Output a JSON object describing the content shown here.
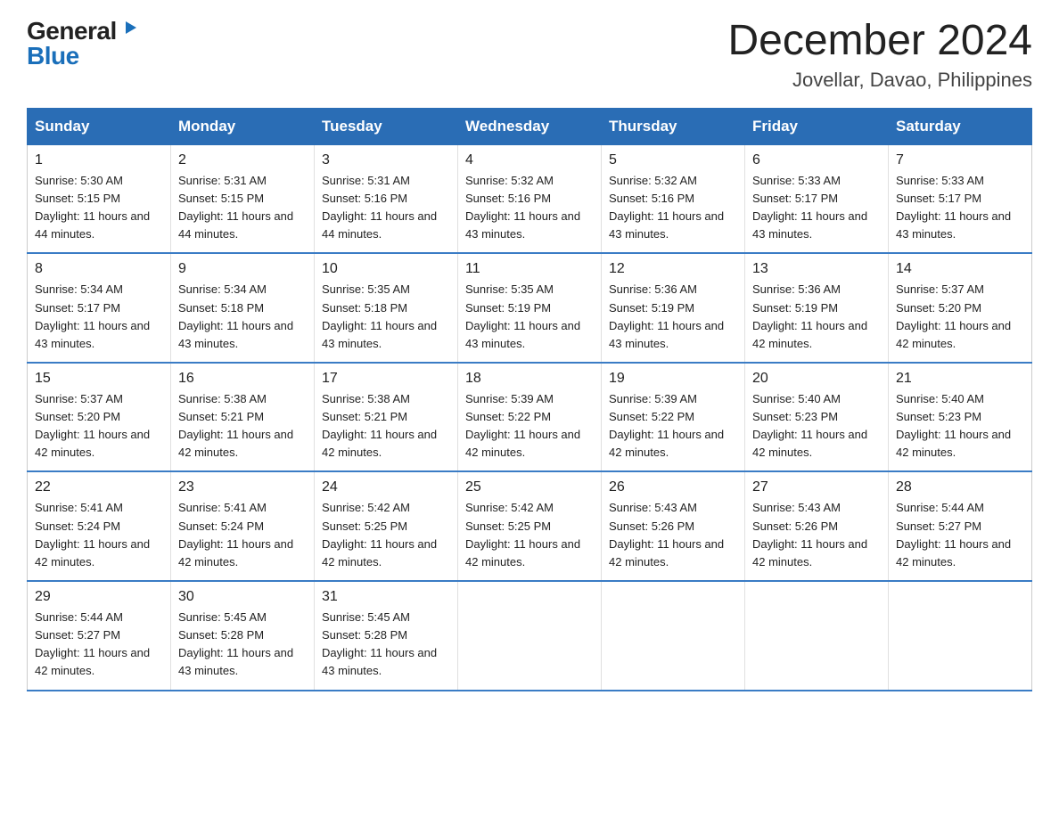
{
  "logo": {
    "general": "General",
    "triangle": "▶",
    "blue": "Blue"
  },
  "title": "December 2024",
  "subtitle": "Jovellar, Davao, Philippines",
  "days_header": [
    "Sunday",
    "Monday",
    "Tuesday",
    "Wednesday",
    "Thursday",
    "Friday",
    "Saturday"
  ],
  "weeks": [
    [
      {
        "day": "1",
        "sunrise": "5:30 AM",
        "sunset": "5:15 PM",
        "daylight": "11 hours and 44 minutes."
      },
      {
        "day": "2",
        "sunrise": "5:31 AM",
        "sunset": "5:15 PM",
        "daylight": "11 hours and 44 minutes."
      },
      {
        "day": "3",
        "sunrise": "5:31 AM",
        "sunset": "5:16 PM",
        "daylight": "11 hours and 44 minutes."
      },
      {
        "day": "4",
        "sunrise": "5:32 AM",
        "sunset": "5:16 PM",
        "daylight": "11 hours and 43 minutes."
      },
      {
        "day": "5",
        "sunrise": "5:32 AM",
        "sunset": "5:16 PM",
        "daylight": "11 hours and 43 minutes."
      },
      {
        "day": "6",
        "sunrise": "5:33 AM",
        "sunset": "5:17 PM",
        "daylight": "11 hours and 43 minutes."
      },
      {
        "day": "7",
        "sunrise": "5:33 AM",
        "sunset": "5:17 PM",
        "daylight": "11 hours and 43 minutes."
      }
    ],
    [
      {
        "day": "8",
        "sunrise": "5:34 AM",
        "sunset": "5:17 PM",
        "daylight": "11 hours and 43 minutes."
      },
      {
        "day": "9",
        "sunrise": "5:34 AM",
        "sunset": "5:18 PM",
        "daylight": "11 hours and 43 minutes."
      },
      {
        "day": "10",
        "sunrise": "5:35 AM",
        "sunset": "5:18 PM",
        "daylight": "11 hours and 43 minutes."
      },
      {
        "day": "11",
        "sunrise": "5:35 AM",
        "sunset": "5:19 PM",
        "daylight": "11 hours and 43 minutes."
      },
      {
        "day": "12",
        "sunrise": "5:36 AM",
        "sunset": "5:19 PM",
        "daylight": "11 hours and 43 minutes."
      },
      {
        "day": "13",
        "sunrise": "5:36 AM",
        "sunset": "5:19 PM",
        "daylight": "11 hours and 42 minutes."
      },
      {
        "day": "14",
        "sunrise": "5:37 AM",
        "sunset": "5:20 PM",
        "daylight": "11 hours and 42 minutes."
      }
    ],
    [
      {
        "day": "15",
        "sunrise": "5:37 AM",
        "sunset": "5:20 PM",
        "daylight": "11 hours and 42 minutes."
      },
      {
        "day": "16",
        "sunrise": "5:38 AM",
        "sunset": "5:21 PM",
        "daylight": "11 hours and 42 minutes."
      },
      {
        "day": "17",
        "sunrise": "5:38 AM",
        "sunset": "5:21 PM",
        "daylight": "11 hours and 42 minutes."
      },
      {
        "day": "18",
        "sunrise": "5:39 AM",
        "sunset": "5:22 PM",
        "daylight": "11 hours and 42 minutes."
      },
      {
        "day": "19",
        "sunrise": "5:39 AM",
        "sunset": "5:22 PM",
        "daylight": "11 hours and 42 minutes."
      },
      {
        "day": "20",
        "sunrise": "5:40 AM",
        "sunset": "5:23 PM",
        "daylight": "11 hours and 42 minutes."
      },
      {
        "day": "21",
        "sunrise": "5:40 AM",
        "sunset": "5:23 PM",
        "daylight": "11 hours and 42 minutes."
      }
    ],
    [
      {
        "day": "22",
        "sunrise": "5:41 AM",
        "sunset": "5:24 PM",
        "daylight": "11 hours and 42 minutes."
      },
      {
        "day": "23",
        "sunrise": "5:41 AM",
        "sunset": "5:24 PM",
        "daylight": "11 hours and 42 minutes."
      },
      {
        "day": "24",
        "sunrise": "5:42 AM",
        "sunset": "5:25 PM",
        "daylight": "11 hours and 42 minutes."
      },
      {
        "day": "25",
        "sunrise": "5:42 AM",
        "sunset": "5:25 PM",
        "daylight": "11 hours and 42 minutes."
      },
      {
        "day": "26",
        "sunrise": "5:43 AM",
        "sunset": "5:26 PM",
        "daylight": "11 hours and 42 minutes."
      },
      {
        "day": "27",
        "sunrise": "5:43 AM",
        "sunset": "5:26 PM",
        "daylight": "11 hours and 42 minutes."
      },
      {
        "day": "28",
        "sunrise": "5:44 AM",
        "sunset": "5:27 PM",
        "daylight": "11 hours and 42 minutes."
      }
    ],
    [
      {
        "day": "29",
        "sunrise": "5:44 AM",
        "sunset": "5:27 PM",
        "daylight": "11 hours and 42 minutes."
      },
      {
        "day": "30",
        "sunrise": "5:45 AM",
        "sunset": "5:28 PM",
        "daylight": "11 hours and 43 minutes."
      },
      {
        "day": "31",
        "sunrise": "5:45 AM",
        "sunset": "5:28 PM",
        "daylight": "11 hours and 43 minutes."
      },
      null,
      null,
      null,
      null
    ]
  ]
}
